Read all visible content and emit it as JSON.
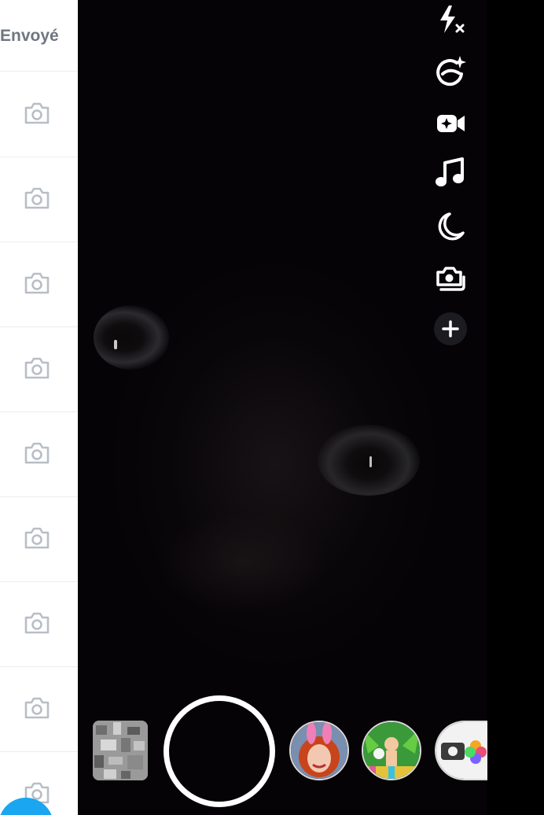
{
  "chat_panel": {
    "status_label": "Envoyé",
    "rows": [
      {
        "icon": "camera-outline-icon"
      },
      {
        "icon": "camera-outline-icon"
      },
      {
        "icon": "camera-outline-icon"
      },
      {
        "icon": "camera-outline-icon"
      },
      {
        "icon": "camera-outline-icon"
      },
      {
        "icon": "camera-outline-icon"
      },
      {
        "icon": "camera-outline-icon"
      },
      {
        "icon": "camera-outline-icon"
      },
      {
        "icon": "camera-outline-icon"
      }
    ],
    "fab_color": "#1aa6f0"
  },
  "camera_toolbar": {
    "items": [
      {
        "name": "flash-off-icon"
      },
      {
        "name": "face-beauty-icon"
      },
      {
        "name": "video-effects-icon"
      },
      {
        "name": "music-note-icon"
      },
      {
        "name": "night-mode-icon"
      },
      {
        "name": "flip-camera-icon"
      },
      {
        "name": "more-plus-icon"
      }
    ]
  },
  "bottom_bar": {
    "memories": "memories-thumbnail",
    "capture": "capture-button",
    "lenses": [
      "bunny-lens",
      "tropical-lens",
      "camera-roll-lens"
    ]
  },
  "colors": {
    "panel_bg": "#ffffff",
    "viewfinder_bg": "#050306",
    "icon_grey": "#b8bec6",
    "accent_blue": "#1aa6f0"
  }
}
